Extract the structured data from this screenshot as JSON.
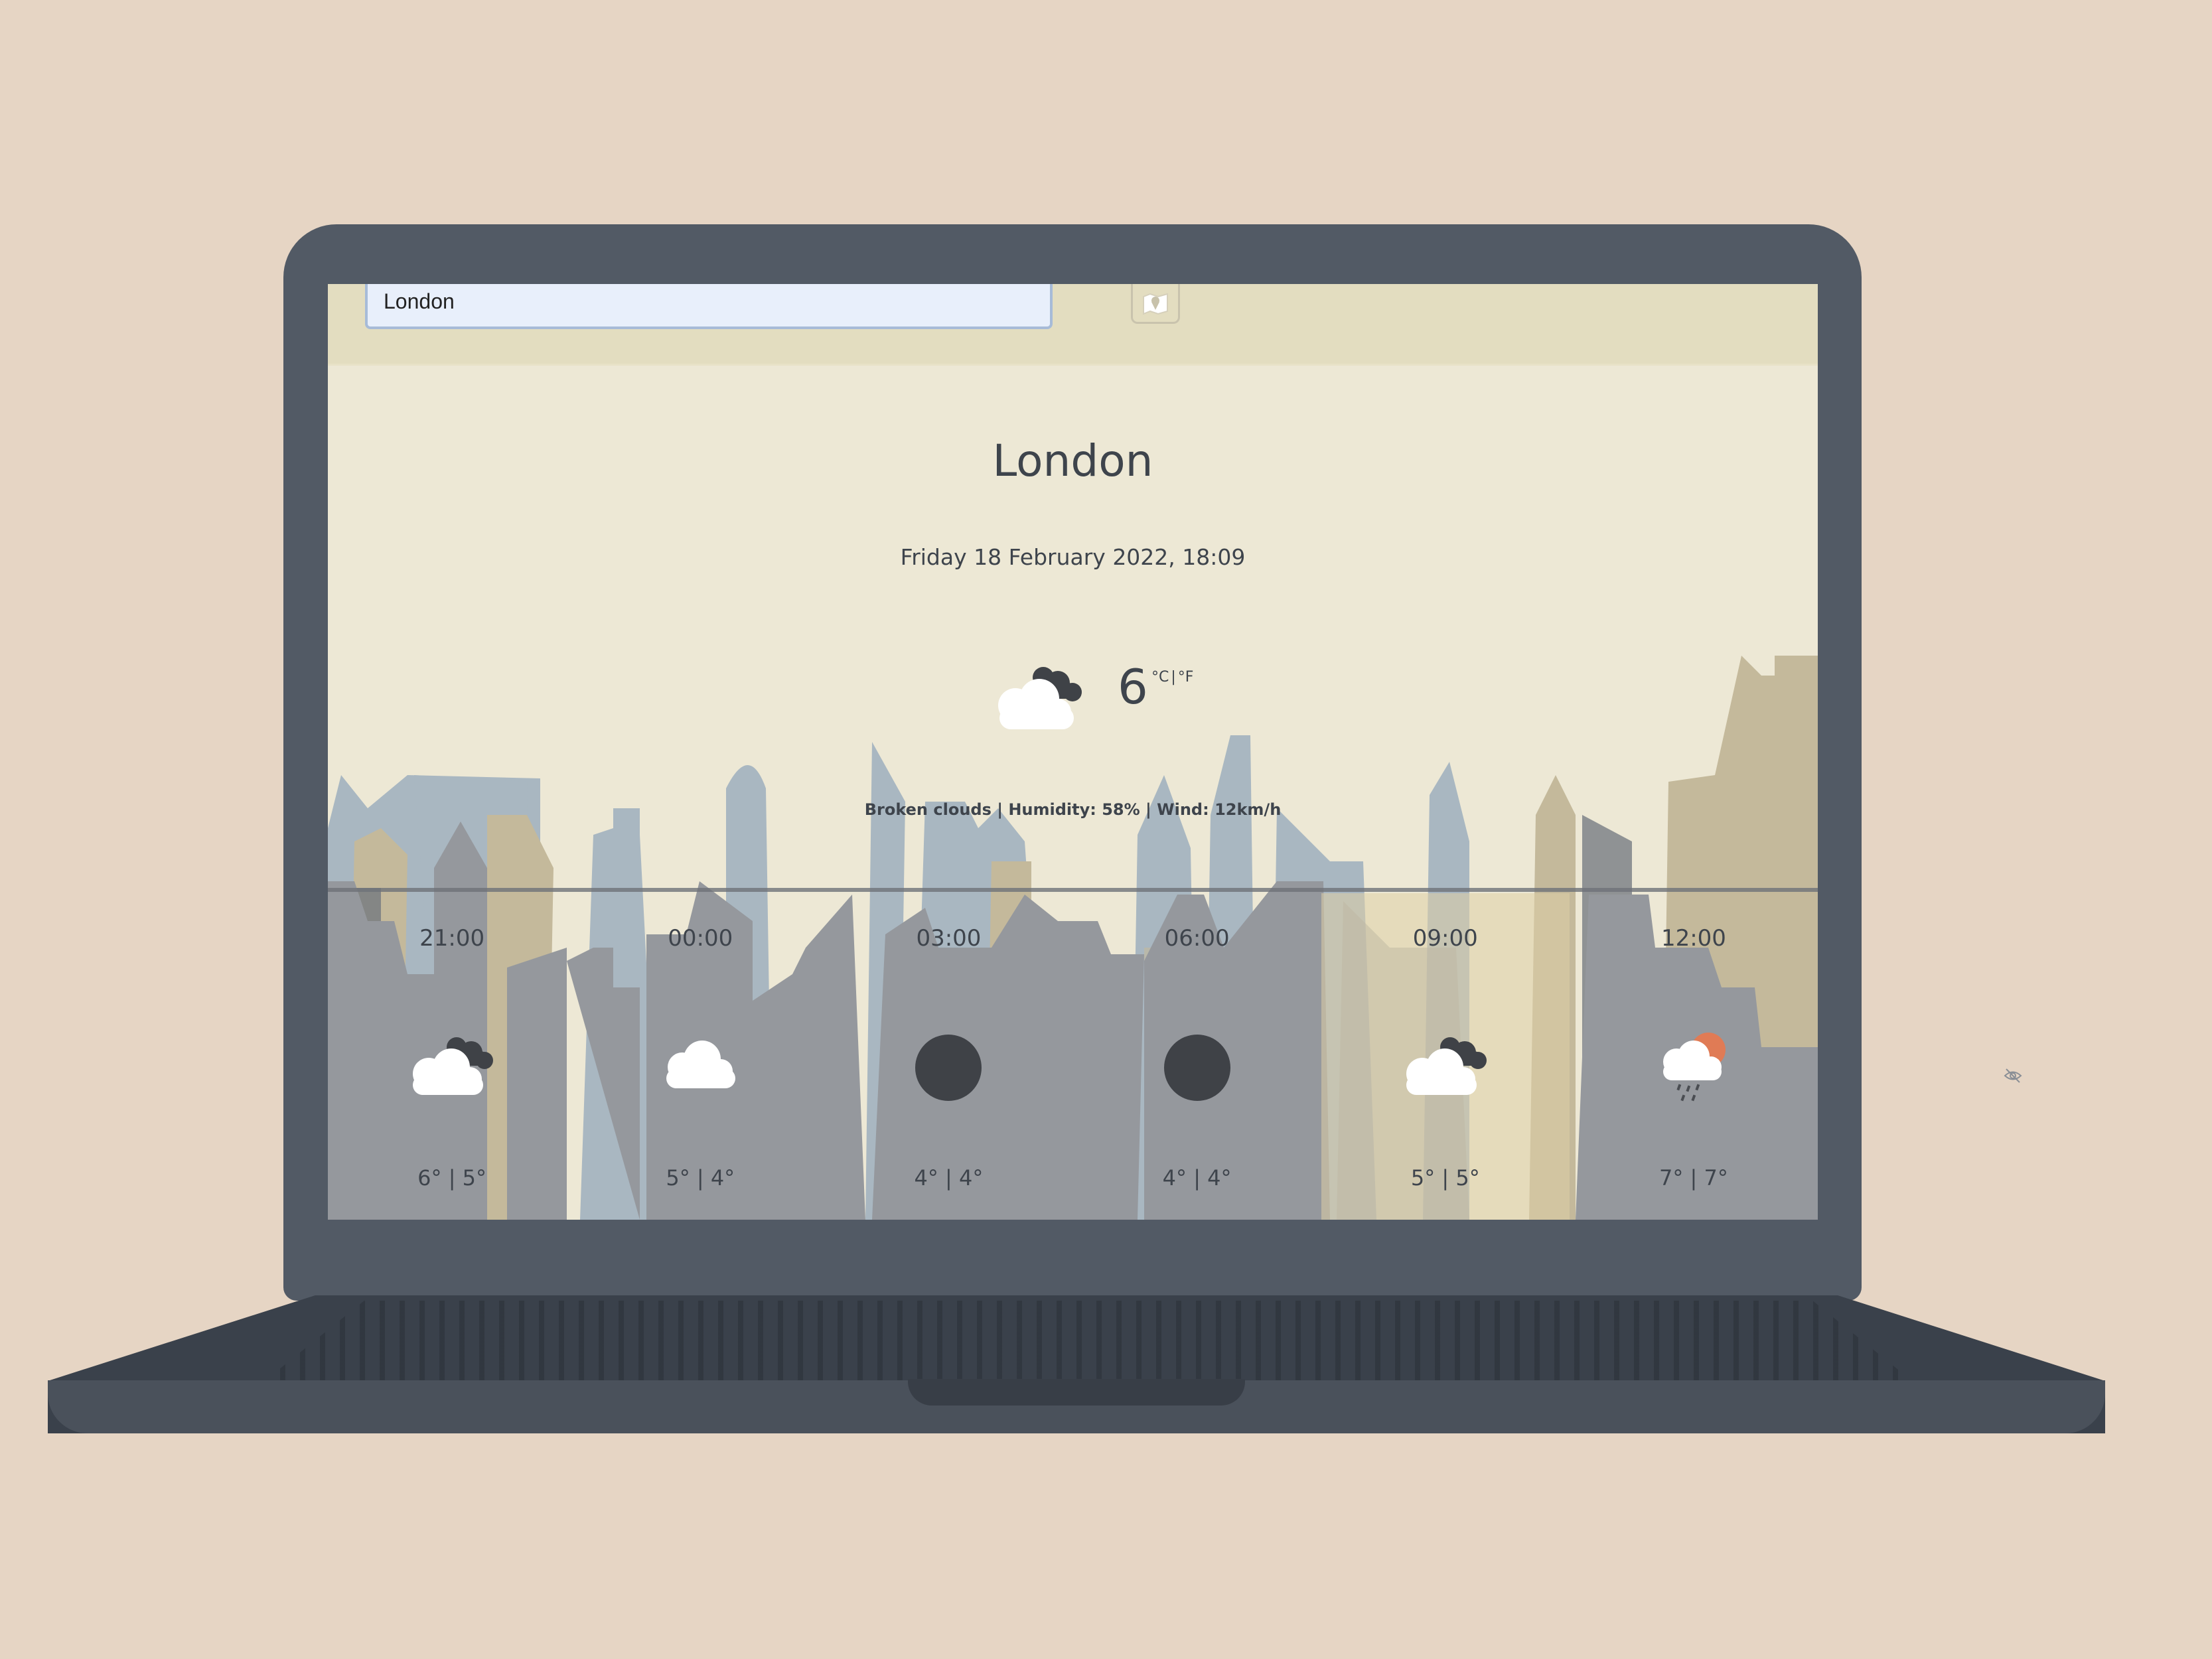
{
  "search": {
    "value": "London"
  },
  "location": {
    "city": "London",
    "datetime": "Friday 18 February 2022, 18:09"
  },
  "current": {
    "temp": "6",
    "unit_c": "°C",
    "unit_sep": "|",
    "unit_f": "°F",
    "icon": "broken-clouds-icon",
    "details": "Broken clouds | Humidity: 58% | Wind: 12km/h"
  },
  "forecast": [
    {
      "time": "21:00",
      "temps": "6° | 5°",
      "icon": "broken-clouds-icon"
    },
    {
      "time": "00:00",
      "temps": "5° | 4°",
      "icon": "cloud-icon"
    },
    {
      "time": "03:00",
      "temps": "4° | 4°",
      "icon": "clear-night-icon"
    },
    {
      "time": "06:00",
      "temps": "4° | 4°",
      "icon": "clear-night-icon"
    },
    {
      "time": "09:00",
      "temps": "5° | 5°",
      "icon": "broken-clouds-icon"
    },
    {
      "time": "12:00",
      "temps": "7° | 7°",
      "icon": "sun-rain-icon"
    }
  ],
  "colors": {
    "background": "#e6d5c4",
    "laptop": "#525a65",
    "screen": "#ede8d5",
    "text": "#3e444c"
  }
}
